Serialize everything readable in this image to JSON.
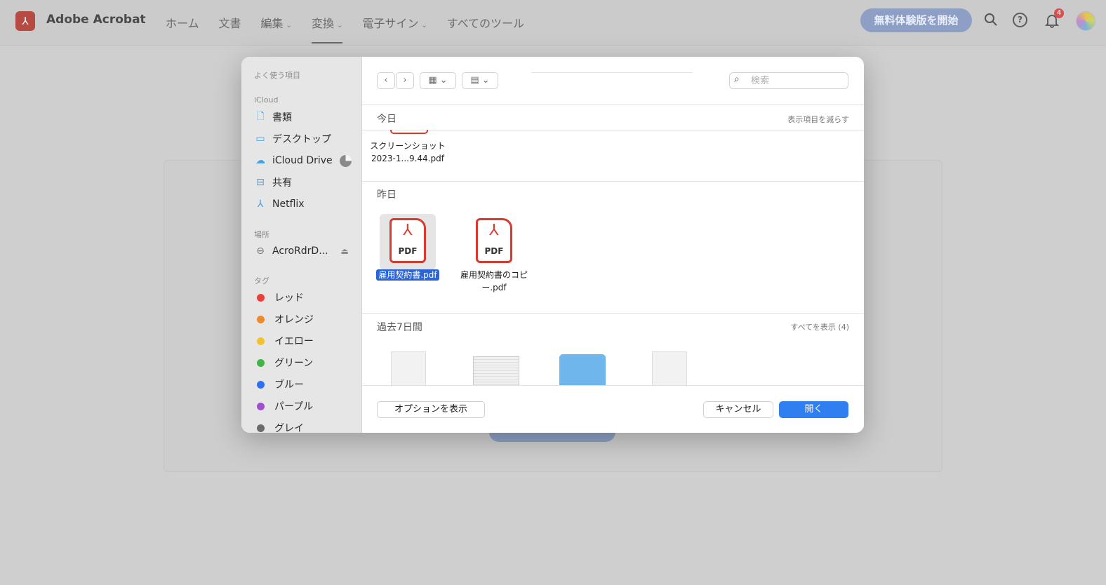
{
  "app": {
    "brand": "Adobe Acrobat",
    "nav": [
      {
        "label": "ホーム",
        "dropdown": false
      },
      {
        "label": "文書",
        "dropdown": false
      },
      {
        "label": "編集",
        "dropdown": true
      },
      {
        "label": "変換",
        "dropdown": true,
        "active": true
      },
      {
        "label": "電子サイン",
        "dropdown": true
      },
      {
        "label": "すべてのツール",
        "dropdown": false
      }
    ],
    "trial_button": "無料体験版を開始",
    "notification_count": "4"
  },
  "dialog": {
    "sidebar": {
      "favorites_label": "よく使う項目",
      "icloud_label": "iCloud",
      "icloud_items": [
        "書類",
        "デスクトップ",
        "iCloud Drive",
        "共有",
        "Netflix"
      ],
      "locations_label": "場所",
      "location_item": "AcroRdrD...",
      "tags_label": "タグ",
      "tags": [
        {
          "label": "レッド",
          "color": "#e8413a"
        },
        {
          "label": "オレンジ",
          "color": "#ef8a2b"
        },
        {
          "label": "イエロー",
          "color": "#f2c230"
        },
        {
          "label": "グリーン",
          "color": "#3fb447"
        },
        {
          "label": "ブルー",
          "color": "#2f6ff0"
        },
        {
          "label": "パープル",
          "color": "#a04ed0"
        },
        {
          "label": "グレイ",
          "color": "#6b6b6b"
        }
      ]
    },
    "search_placeholder": "検索",
    "groups": {
      "today": {
        "title": "今日",
        "link": "表示項目を減らす",
        "file_line1": "スクリーンショット",
        "file_line2": "2023-1...9.44.pdf"
      },
      "yesterday": {
        "title": "昨日",
        "files": [
          {
            "line1": "雇用契約書.pdf",
            "line2": ""
          },
          {
            "line1": "雇用契約書のコピ",
            "line2": "ー.pdf"
          }
        ],
        "pdf_label": "PDF"
      },
      "week": {
        "title": "過去7日間",
        "link": "すべてを表示 (4)"
      }
    },
    "footer": {
      "options_button": "オプションを表示",
      "cancel_button": "キャンセル",
      "open_button": "開く"
    }
  }
}
